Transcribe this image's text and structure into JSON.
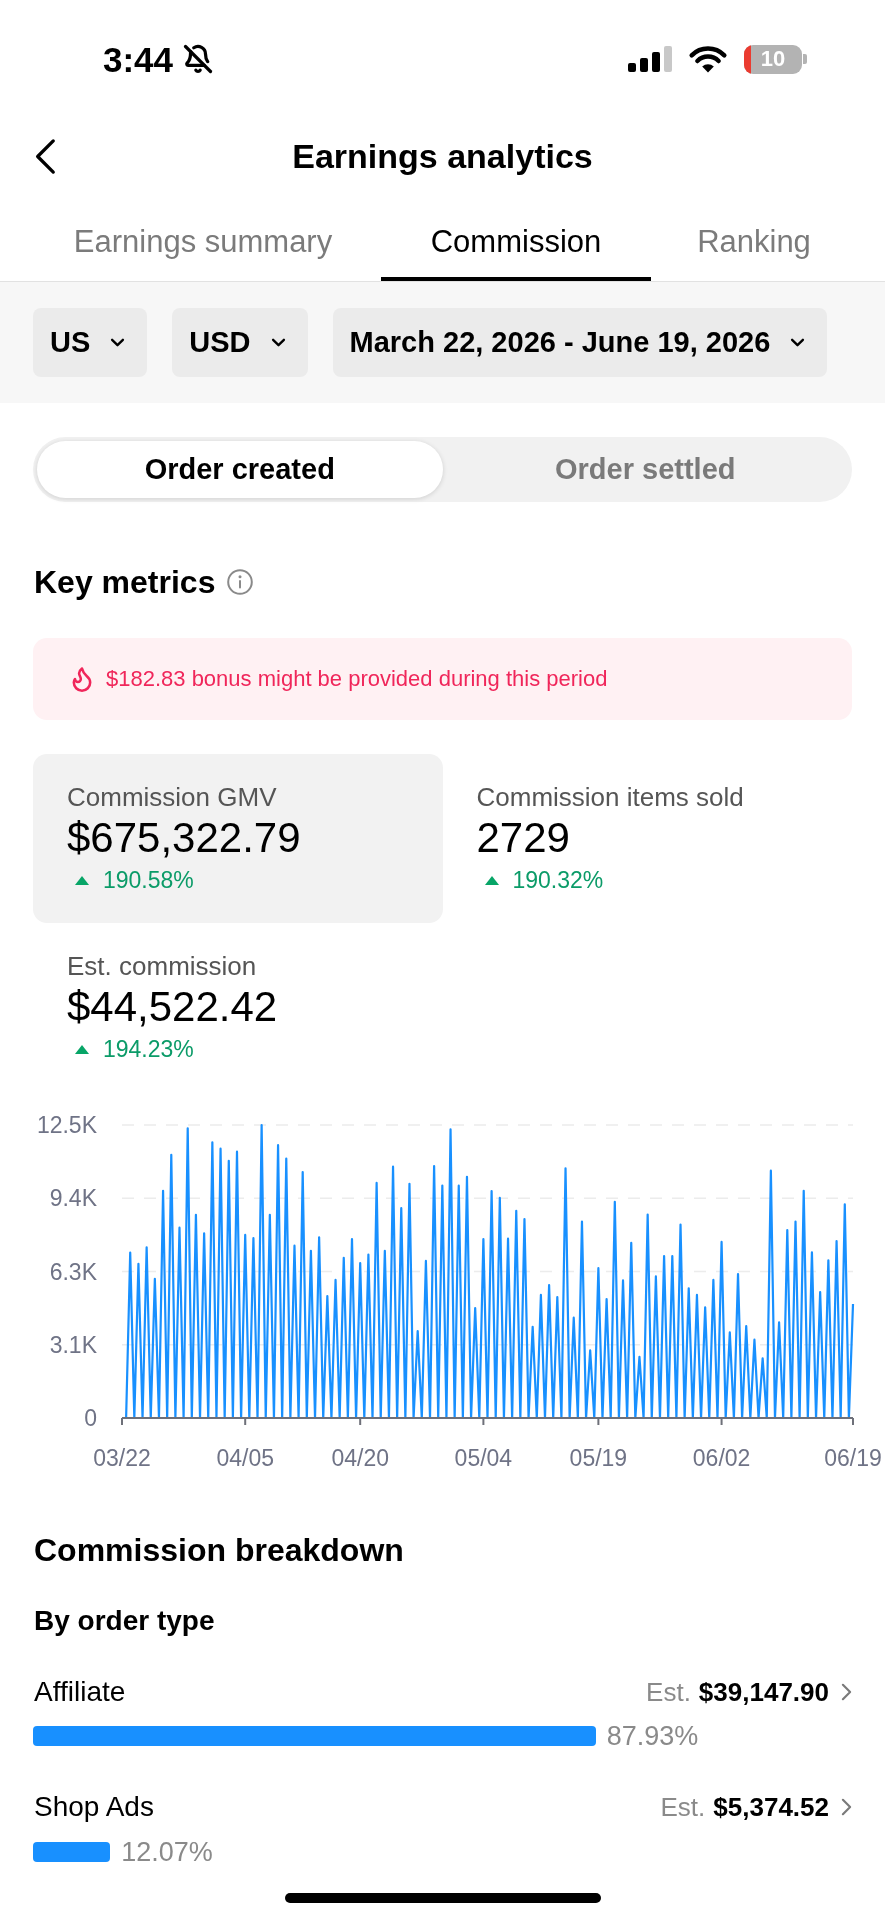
{
  "status_bar": {
    "time": "3:44",
    "silent_mode": true,
    "battery": "10"
  },
  "header": {
    "title": "Earnings analytics"
  },
  "tabs": [
    {
      "label": "Earnings summary",
      "selected": false
    },
    {
      "label": "Commission",
      "selected": true
    },
    {
      "label": "Ranking",
      "selected": false
    }
  ],
  "filters": [
    {
      "label": "US"
    },
    {
      "label": "USD"
    },
    {
      "label": "March 22, 2026 - June 19, 2026"
    }
  ],
  "order_status_toggle": [
    {
      "label": "Order created",
      "selected": true
    },
    {
      "label": "Order settled",
      "selected": false
    }
  ],
  "key_metrics": {
    "title": "Key metrics",
    "bonus_notice": "$182.83 bonus might be provided during this period",
    "metrics": [
      {
        "label": "Commission GMV",
        "value": "$675,322.79",
        "change": "190.58%",
        "rising": true,
        "selected": true
      },
      {
        "label": "Commission items sold",
        "value": "2729",
        "change": "190.32%",
        "rising": true,
        "selected": false
      },
      {
        "label": "Est. commission",
        "value": "$44,522.42",
        "change": "194.23%",
        "rising": true,
        "selected": false
      }
    ],
    "chart_data": {
      "type": "line",
      "grid": true,
      "categories": [
        "03/22",
        null,
        null,
        null,
        null,
        null,
        null,
        null,
        null,
        null,
        null,
        null,
        null,
        null,
        null,
        null,
        null,
        null,
        null,
        null,
        null,
        null,
        null,
        null,
        null,
        null,
        null,
        null,
        null,
        null,
        "04/05",
        null,
        null,
        null,
        null,
        null,
        null,
        null,
        null,
        null,
        null,
        null,
        null,
        null,
        null,
        null,
        null,
        null,
        null,
        null,
        null,
        null,
        null,
        null,
        null,
        null,
        null,
        null,
        "04/20",
        null,
        null,
        null,
        null,
        null,
        null,
        null,
        null,
        null,
        null,
        null,
        null,
        null,
        null,
        null,
        null,
        null,
        null,
        null,
        null,
        null,
        null,
        null,
        null,
        null,
        null,
        null,
        null,
        null,
        "05/04",
        null,
        null,
        null,
        null,
        null,
        null,
        null,
        null,
        null,
        null,
        null,
        null,
        null,
        null,
        null,
        null,
        null,
        null,
        null,
        null,
        null,
        null,
        null,
        null,
        null,
        null,
        null,
        "05/19",
        null,
        null,
        null,
        null,
        null,
        null,
        null,
        null,
        null,
        null,
        null,
        null,
        null,
        null,
        null,
        null,
        null,
        null,
        null,
        null,
        null,
        null,
        null,
        null,
        null,
        null,
        null,
        null,
        null,
        "06/02",
        null,
        null,
        null,
        null,
        null,
        null,
        null,
        null,
        null,
        null,
        null,
        null,
        null,
        null,
        null,
        null,
        null,
        null,
        null,
        null,
        null,
        null,
        null,
        null,
        null,
        null,
        null,
        null,
        null,
        null,
        null,
        "06/19"
      ],
      "series": [
        {
          "color": "#1890ff",
          "values": [
            0,
            0,
            7060,
            0,
            6580,
            0,
            7280,
            0,
            5940,
            0,
            9690,
            0,
            11230,
            0,
            8120,
            0,
            12360,
            0,
            8670,
            0,
            7880,
            0,
            11760,
            0,
            11490,
            0,
            10970,
            0,
            11360,
            0,
            7810,
            0,
            7670,
            0,
            12500,
            0,
            8670,
            0,
            11640,
            0,
            11070,
            0,
            7350,
            0,
            10490,
            0,
            7130,
            0,
            7710,
            0,
            5200,
            0,
            5890,
            0,
            6830,
            0,
            7630,
            0,
            6610,
            0,
            6970,
            0,
            10030,
            0,
            7130,
            0,
            10720,
            0,
            8950,
            0,
            9990,
            0,
            3710,
            0,
            6700,
            0,
            10750,
            0,
            9920,
            0,
            12310,
            0,
            9910,
            0,
            10290,
            0,
            4690,
            0,
            7630,
            0,
            9680,
            0,
            9390,
            0,
            7650,
            0,
            8840,
            0,
            8490,
            0,
            3890,
            0,
            5250,
            0,
            5670,
            0,
            5160,
            0,
            10650,
            0,
            4280,
            0,
            8380,
            0,
            2890,
            0,
            6390,
            0,
            5070,
            0,
            9220,
            0,
            5870,
            0,
            7470,
            0,
            2610,
            0,
            8680,
            0,
            6040,
            0,
            6910,
            0,
            6910,
            0,
            8250,
            0,
            5530,
            0,
            5250,
            0,
            4720,
            0,
            5890,
            0,
            7510,
            0,
            3650,
            0,
            6140,
            0,
            3920,
            0,
            3340,
            0,
            2550,
            0,
            10550,
            0,
            4080,
            0,
            8020,
            0,
            8380,
            0,
            9690,
            0,
            7070,
            0,
            5370,
            0,
            6730,
            0,
            7550,
            0,
            9120,
            0,
            4860
          ]
        }
      ],
      "ylim": [
        0,
        12500
      ],
      "yticks": [
        0,
        {
          "value": 3125,
          "label": "3.1K"
        },
        {
          "value": 6250,
          "label": "6.3K"
        },
        {
          "value": 9375,
          "label": "9.4K"
        },
        {
          "value": 12500,
          "label": "12.5K"
        }
      ]
    }
  },
  "commission_breakdown": {
    "title": "Commission breakdown",
    "subtitle": "By order type",
    "items": [
      {
        "label": "Affiliate",
        "prefix": "Est.",
        "amount": "$39,147.90",
        "level": 0.8793,
        "share": "87.93%"
      },
      {
        "label": "Shop Ads",
        "prefix": "Est.",
        "amount": "$5,374.52",
        "level": 0.1207,
        "share": "12.07%"
      }
    ]
  }
}
